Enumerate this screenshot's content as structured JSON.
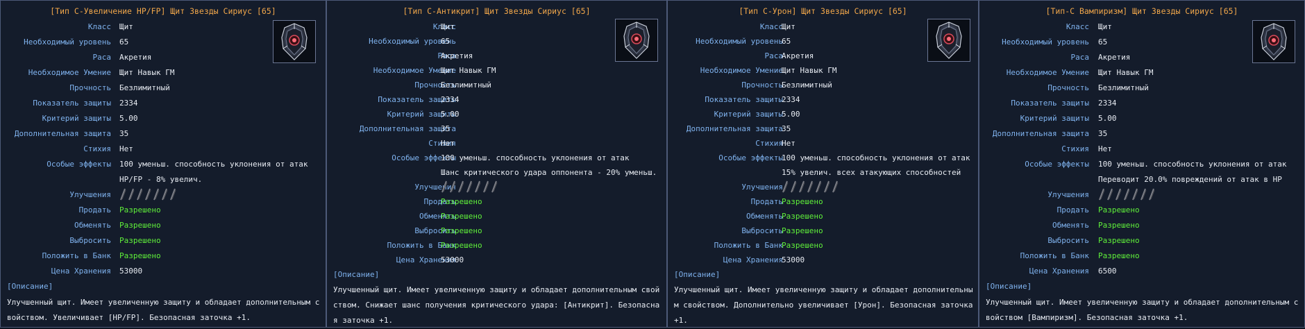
{
  "panels": [
    {
      "title": "[Тип C-Увеличение HP/FP] Щит Звезды Сириус [65]",
      "rows": [
        {
          "label": "Класс",
          "value": "Щит"
        },
        {
          "label": "Необходимый уровень",
          "value": "65"
        },
        {
          "label": "Раса",
          "value": "Акретия"
        },
        {
          "label": "Необходимое Умение",
          "value": "Щит Навык ГМ"
        },
        {
          "label": "Прочность",
          "value": "Безлимитный"
        },
        {
          "label": "Показатель защиты",
          "value": "2334"
        },
        {
          "label": "Критерий защиты",
          "value": "5.00"
        },
        {
          "label": "Дополнительная защита",
          "value": "35"
        },
        {
          "label": "Стихия",
          "value": "Нет"
        },
        {
          "label": "Особые эффекты",
          "value": "100 уменьш. способность уклонения от атак"
        },
        {
          "label": "",
          "value": "HP/FP - 8% увелич."
        }
      ],
      "upgrades_label": "Улучшения",
      "upgrade_slots": 7,
      "perms": [
        {
          "label": "Продать",
          "value": "Разрешено"
        },
        {
          "label": "Обменять",
          "value": "Разрешено"
        },
        {
          "label": "Выбросить",
          "value": "Разрешено"
        },
        {
          "label": "Положить в Банк",
          "value": "Разрешено"
        }
      ],
      "price_label": "Цена Хранения",
      "price": "53000",
      "desc_head": "[Описание]",
      "desc": "Улучшенный щит. Имеет увеличенную защиту и обладает дополнительным свойством. Увеличивает [HP/FP]. Безопасная заточка +1."
    },
    {
      "title": "[Тип C-Антикрит] Щит Звезды Сириус [65]",
      "rows": [
        {
          "label": "Класс",
          "value": "Щит"
        },
        {
          "label": "Необходимый уровень",
          "value": "65"
        },
        {
          "label": "Раса",
          "value": "Акретия"
        },
        {
          "label": "Необходимое Умение",
          "value": "Щит Навык ГМ"
        },
        {
          "label": "Прочность",
          "value": "Безлимитный"
        },
        {
          "label": "Показатель защиты",
          "value": "2334"
        },
        {
          "label": "Критерий защиты",
          "value": "5.00"
        },
        {
          "label": "Дополнительная защита",
          "value": "35"
        },
        {
          "label": "Стихия",
          "value": "Нет"
        },
        {
          "label": "Особые эффекты",
          "value": "100 уменьш. способность уклонения от атак"
        },
        {
          "label": "",
          "value": "Шанс критического удара оппонента - 20% уменьш."
        }
      ],
      "upgrades_label": "Улучшения",
      "upgrade_slots": 7,
      "perms": [
        {
          "label": "Продать",
          "value": "Разрешено"
        },
        {
          "label": "Обменять",
          "value": "Разрешено"
        },
        {
          "label": "Выбросить",
          "value": "Разрешено"
        },
        {
          "label": "Положить в Банк",
          "value": "Разрешено"
        }
      ],
      "price_label": "Цена Хранения",
      "price": "53000",
      "desc_head": "[Описание]",
      "desc": "Улучшенный щит. Имеет увеличенную защиту и обладает дополнительным свойством. Снижает шанс получения критического удара: [Антикрит]. Безопасная заточка +1."
    },
    {
      "title": "[Тип C-Урон] Щит Звезды Сириус [65]",
      "rows": [
        {
          "label": "Класс",
          "value": "Щит"
        },
        {
          "label": "Необходимый уровень",
          "value": "65"
        },
        {
          "label": "Раса",
          "value": "Акретия"
        },
        {
          "label": "Необходимое Умение",
          "value": "Щит Навык ГМ"
        },
        {
          "label": "Прочность",
          "value": "Безлимитный"
        },
        {
          "label": "Показатель защиты",
          "value": "2334"
        },
        {
          "label": "Критерий защиты",
          "value": "5.00"
        },
        {
          "label": "Дополнительная защита",
          "value": "35"
        },
        {
          "label": "Стихия",
          "value": "Нет"
        },
        {
          "label": "Особые эффекты",
          "value": "100 уменьш. способность уклонения от атак"
        },
        {
          "label": "",
          "value": "15% увелич. всех атакующих способностей"
        }
      ],
      "upgrades_label": "Улучшения",
      "upgrade_slots": 7,
      "perms": [
        {
          "label": "Продать",
          "value": "Разрешено"
        },
        {
          "label": "Обменять",
          "value": "Разрешено"
        },
        {
          "label": "Выбросить",
          "value": "Разрешено"
        },
        {
          "label": "Положить в Банк",
          "value": "Разрешено"
        }
      ],
      "price_label": "Цена Хранения",
      "price": "53000",
      "desc_head": "[Описание]",
      "desc": "Улучшенный щит. Имеет увеличенную защиту и обладает дополнительным свойством. Дополнительно увеличивает [Урон]. Безопасная заточка +1."
    },
    {
      "title": "[Тип-C Вампиризм] Щит Звезды Сириус [65]",
      "rows": [
        {
          "label": "Класс",
          "value": "Щит"
        },
        {
          "label": "Необходимый уровень",
          "value": "65"
        },
        {
          "label": "Раса",
          "value": "Акретия"
        },
        {
          "label": "Необходимое Умение",
          "value": "Щит Навык ГМ"
        },
        {
          "label": "Прочность",
          "value": "Безлимитный"
        },
        {
          "label": "Показатель защиты",
          "value": "2334"
        },
        {
          "label": "Критерий защиты",
          "value": "5.00"
        },
        {
          "label": "Дополнительная защита",
          "value": "35"
        },
        {
          "label": "Стихия",
          "value": "Нет"
        },
        {
          "label": "Особые эффекты",
          "value": "100 уменьш. способность уклонения от атак"
        },
        {
          "label": "",
          "value": "Переводит 20.0% повреждений от атак в HP"
        }
      ],
      "upgrades_label": "Улучшения",
      "upgrade_slots": 7,
      "perms": [
        {
          "label": "Продать",
          "value": "Разрешено"
        },
        {
          "label": "Обменять",
          "value": "Разрешено"
        },
        {
          "label": "Выбросить",
          "value": "Разрешено"
        },
        {
          "label": "Положить в Банк",
          "value": "Разрешено"
        }
      ],
      "price_label": "Цена Хранения",
      "price": "6500",
      "desc_head": "[Описание]",
      "desc": "Улучшенный щит. Имеет увеличенную защиту и обладает дополнительным свойством [Вампиризм]. Безопасная заточка +1."
    }
  ],
  "icons": {
    "item": "shield-icon",
    "upgrade_slot": "empty-upgrade-slot-icon"
  },
  "colors": {
    "title": "#f0a64a",
    "label": "#7fb2ee",
    "value": "#e7ebf2",
    "allowed": "#5ff03a"
  }
}
